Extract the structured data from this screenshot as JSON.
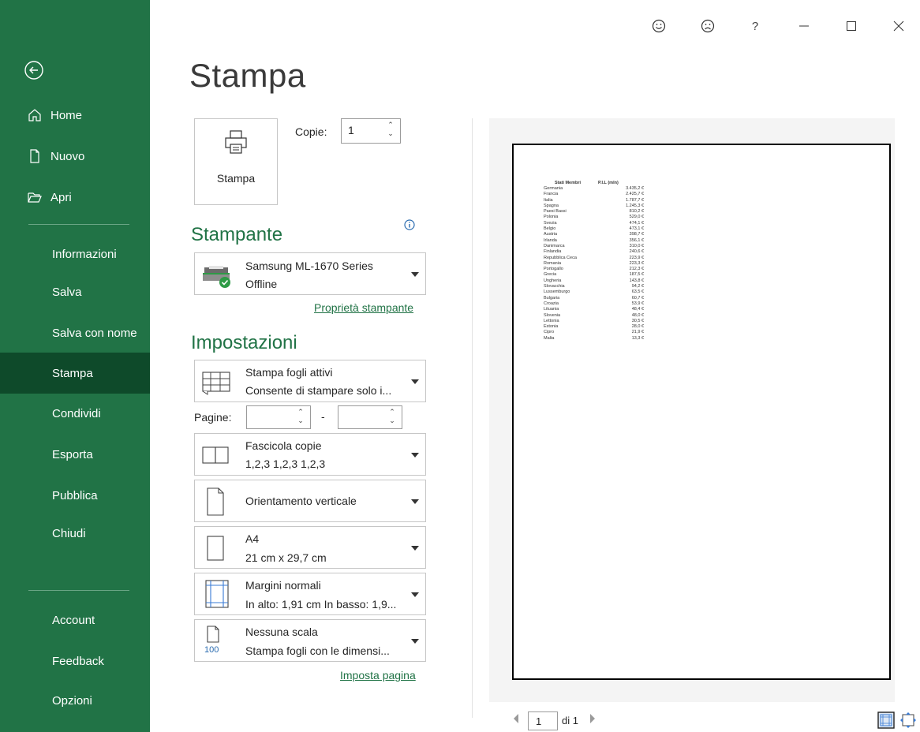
{
  "sidebar": {
    "back_icon": "back-arrow-icon",
    "top_items": [
      {
        "label": "Home",
        "icon": "home-icon"
      },
      {
        "label": "Nuovo",
        "icon": "new-document-icon"
      },
      {
        "label": "Apri",
        "icon": "open-folder-icon"
      }
    ],
    "items": [
      "Informazioni",
      "Salva",
      "Salva con nome",
      "Stampa",
      "Condividi",
      "Esporta",
      "Pubblica",
      "Chiudi"
    ],
    "active": "Stampa",
    "bottom_items": [
      "Account",
      "Feedback",
      "Opzioni"
    ],
    "colors": {
      "background": "#217346",
      "active": "#0e4a2a"
    }
  },
  "titlebar": {
    "buttons": [
      "smile-icon",
      "frown-icon",
      "help-icon",
      "minimize-icon",
      "maximize-icon",
      "close-icon"
    ],
    "help_label": "?"
  },
  "page": {
    "title": "Stampa",
    "print_button": "Stampa",
    "copies_label": "Copie:",
    "copies_value": "1"
  },
  "printer": {
    "section_title": "Stampante",
    "name": "Samsung ML-1670 Series",
    "status": "Offline",
    "properties_link": "Proprietà stampante"
  },
  "settings": {
    "section_title": "Impostazioni",
    "what": {
      "line1": "Stampa fogli attivi",
      "line2": "Consente di stampare solo i..."
    },
    "pages_label": "Pagine:",
    "pages_from": "",
    "pages_to": "",
    "pages_dash": "-",
    "collate": {
      "line1": "Fascicola copie",
      "line2": "1,2,3   1,2,3   1,2,3"
    },
    "orientation": {
      "line1": "Orientamento verticale"
    },
    "paper": {
      "line1": "A4",
      "line2": "21 cm x 29,7 cm"
    },
    "margins": {
      "line1": "Margini normali",
      "line2": "In alto: 1,91 cm In basso: 1,9..."
    },
    "scaling": {
      "line1": "Nessuna scala",
      "line2": "Stampa fogli con le dimensi...",
      "icon_text": "100"
    },
    "page_setup_link": "Imposta pagina"
  },
  "preview": {
    "headers": [
      "Stati Membri",
      "P.I.L (mln)"
    ],
    "rows": [
      [
        "Germania",
        "3.435,2 €"
      ],
      [
        "Francia",
        "2.425,7 €"
      ],
      [
        "Italia",
        "1.787,7 €"
      ],
      [
        "Spagna",
        "1.245,3 €"
      ],
      [
        "Paesi Bassi",
        "810,2 €"
      ],
      [
        "Polonia",
        "529,0 €"
      ],
      [
        "Svezia",
        "474,1 €"
      ],
      [
        "Belgio",
        "473,1 €"
      ],
      [
        "Austria",
        "398,7 €"
      ],
      [
        "Irlanda",
        "356,1 €"
      ],
      [
        "Danimarca",
        "310,0 €"
      ],
      [
        "Finlandia",
        "240,6 €"
      ],
      [
        "Repubblica Ceca",
        "223,9 €"
      ],
      [
        "Romania",
        "223,3 €"
      ],
      [
        "Portogallo",
        "212,3 €"
      ],
      [
        "Grecia",
        "187,5 €"
      ],
      [
        "Ungheria",
        "143,8 €"
      ],
      [
        "Slovacchia",
        "94,2 €"
      ],
      [
        "Lussemburgo",
        "63,5 €"
      ],
      [
        "Bulgaria",
        "60,7 €"
      ],
      [
        "Croazia",
        "53,9 €"
      ],
      [
        "Lituania",
        "48,4 €"
      ],
      [
        "Slovenia",
        "48,0 €"
      ],
      [
        "Lettonia",
        "30,5 €"
      ],
      [
        "Estonia",
        "28,0 €"
      ],
      [
        "Cipro",
        "21,9 €"
      ],
      [
        "Malta",
        "13,3 €"
      ]
    ],
    "current_page": "1",
    "of_pages": "di 1"
  }
}
